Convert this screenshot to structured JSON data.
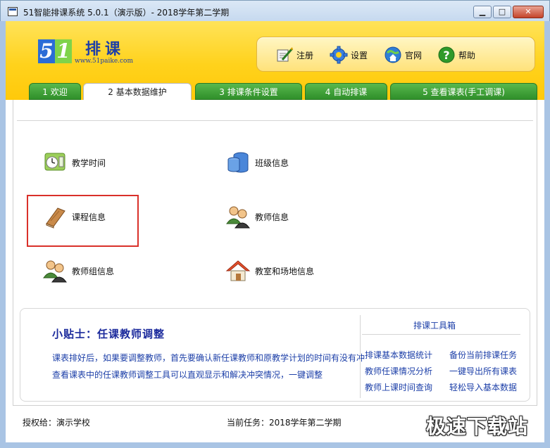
{
  "window": {
    "title": "51智能排课系统 5.0.1（演示版）- 2018学年第二学期",
    "minimize": "▁",
    "maximize": "□",
    "close": "✕"
  },
  "logo": {
    "digit1": "5",
    "digit2": "1",
    "name": "排课",
    "url": "www.51paike.com"
  },
  "toolbar": {
    "register": "注册",
    "settings": "设置",
    "website": "官网",
    "help": "帮助"
  },
  "tabs": [
    {
      "label": "1 欢迎",
      "active": false
    },
    {
      "label": "2 基本数据维护",
      "active": true
    },
    {
      "label": "3 排课条件设置",
      "active": false
    },
    {
      "label": "4 自动排课",
      "active": false
    },
    {
      "label": "5 查看课表(手工调课)",
      "active": false
    }
  ],
  "items": {
    "teaching_time": "教学时间",
    "class_info": "班级信息",
    "course_info": "课程信息",
    "teacher_info": "教师信息",
    "teacher_group": "教师组信息",
    "classroom": "教室和场地信息"
  },
  "tips": {
    "title": "小贴士：任课教师调整",
    "line1": "课表排好后，如果要调整教师，首先要确认新任课教师和原教学计划的时间有没有冲",
    "line2": "查看课表中的任课教师调整工具可以直观显示和解决冲突情况，一键调整"
  },
  "toolbox": {
    "title": "排课工具箱",
    "links": [
      "排课基本数据统计",
      "备份当前排课任务",
      "教师任课情况分析",
      "一键导出所有课表",
      "教师上课时间查询",
      "轻松导入基本数据"
    ]
  },
  "status": {
    "licensed_to": "授权给：演示学校",
    "current_task": "当前任务：2018学年第二学期"
  },
  "watermark": "极速下载站",
  "colors": {
    "header_yellow": "#ffd21c",
    "tab_green": "#3a9a33",
    "link_blue": "#1c3fa8",
    "highlight_red": "#d9302a"
  }
}
